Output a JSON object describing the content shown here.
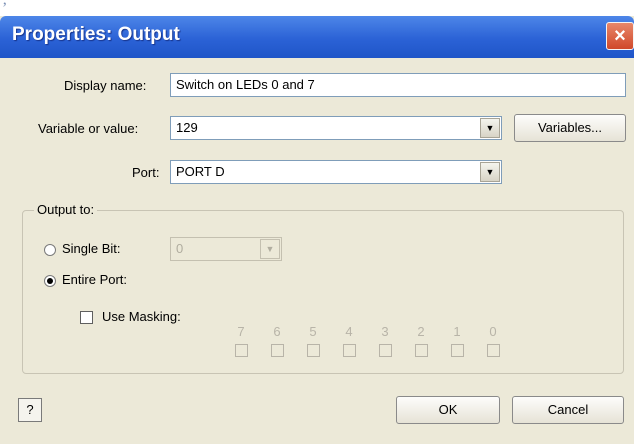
{
  "window": {
    "corner_mark": "ʼ",
    "title": "Properties: Output",
    "close_glyph": "×"
  },
  "form": {
    "display_name_label": "Display name:",
    "display_name_value": "Switch on LEDs 0 and 7",
    "variable_label": "Variable or value:",
    "variable_value": "129",
    "variables_button": "Variables...",
    "port_label": "Port:",
    "port_value": "PORT D",
    "combo_arrow": "▼"
  },
  "output_to": {
    "group_label": "Output to:",
    "single_bit_label": "Single Bit:",
    "single_bit_value": "0",
    "entire_port_label": "Entire Port:",
    "use_masking_label": "Use Masking:",
    "selected": "entire_port",
    "bits": [
      "7",
      "6",
      "5",
      "4",
      "3",
      "2",
      "1",
      "0"
    ]
  },
  "footer": {
    "help_label": "?",
    "ok_label": "OK",
    "cancel_label": "Cancel"
  },
  "colors": {
    "title_bar": "#2b62d6",
    "close_button": "#d0482a",
    "dialog_bg": "#ece9d8"
  }
}
